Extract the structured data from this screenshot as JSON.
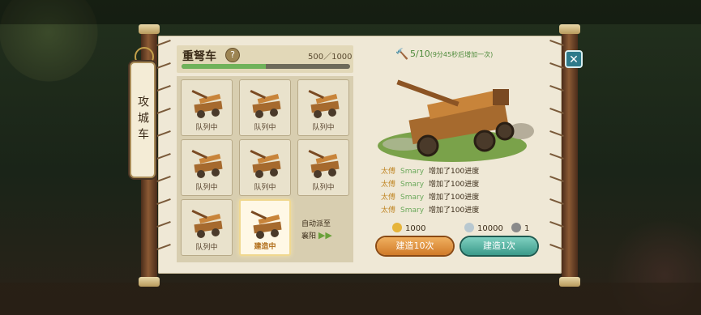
{
  "side_tab": {
    "label": "攻城车"
  },
  "header": {
    "title": "重弩车",
    "help_label": "?",
    "progress_text": "500／1000",
    "progress_fraction": 0.5
  },
  "grid": {
    "cells": [
      {
        "label": "队列中",
        "state": "queued"
      },
      {
        "label": "队列中",
        "state": "queued"
      },
      {
        "label": "队列中",
        "state": "queued"
      },
      {
        "label": "队列中",
        "state": "queued"
      },
      {
        "label": "队列中",
        "state": "queued"
      },
      {
        "label": "队列中",
        "state": "queued"
      },
      {
        "label": "队列中",
        "state": "queued"
      },
      {
        "label": "建造中",
        "state": "building"
      }
    ],
    "auto_dispatch": {
      "line1": "自动派至",
      "line2": "襄阳",
      "arrows": "▶▶"
    }
  },
  "timer": {
    "current": "5",
    "total": "/10",
    "note": "(9分45秒后增加一次)"
  },
  "log": [
    {
      "who": "太傅",
      "name": "Smary",
      "action": "增加了100进度"
    },
    {
      "who": "太傅",
      "name": "Smary",
      "action": "增加了100进度"
    },
    {
      "who": "太傅",
      "name": "Smary",
      "action": "增加了100进度"
    },
    {
      "who": "太傅",
      "name": "Smary",
      "action": "增加了100进度"
    }
  ],
  "costs": {
    "gold": "1000",
    "silver": "10000",
    "tokens": "1"
  },
  "buttons": {
    "build10": "建造10次",
    "build1": "建造1次",
    "close": "✕"
  },
  "icons": {
    "hammer": "hammer-icon",
    "gold": "gold-coin-icon",
    "silver": "silver-coin-icon",
    "token": "token-icon"
  },
  "colors": {
    "progress": "#6fb25a",
    "orange_button": "#d07a28",
    "teal_button": "#3b9a8a",
    "name_green": "#6aa85a",
    "title_gold": "#c28a2c"
  }
}
